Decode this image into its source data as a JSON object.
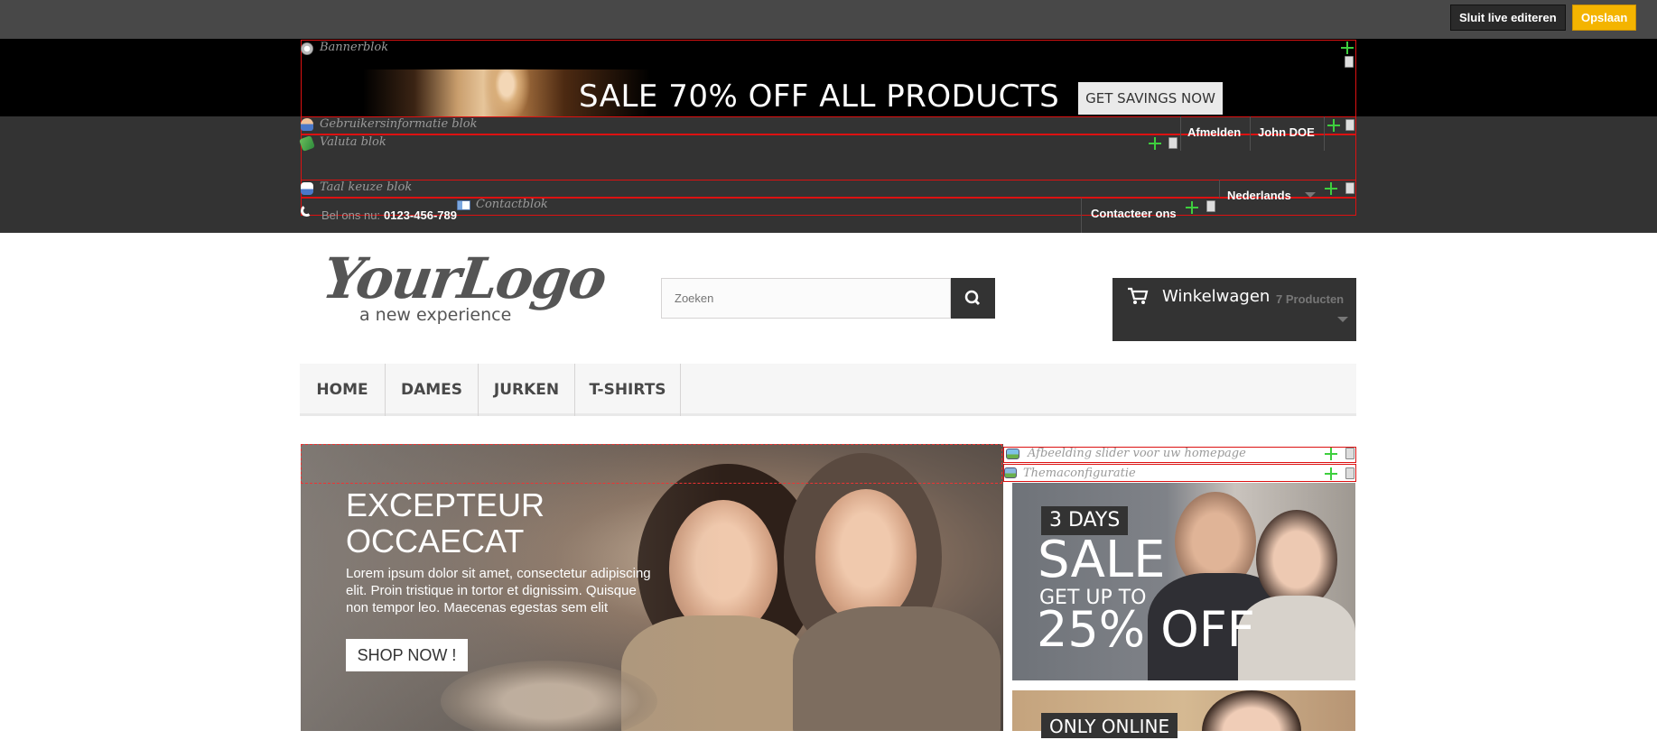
{
  "admin_bar": {
    "close_live_label": "Sluit live editeren",
    "save_label": "Opslaan"
  },
  "modules": {
    "banner": "Bannerblok",
    "user_info": "Gebruikersinformatie blok",
    "currency": "Valuta blok",
    "language": "Taal keuze blok",
    "contact": "Contactblok",
    "slider": "Afbeelding slider voor uw homepage",
    "theme_config": "Themaconfiguratie"
  },
  "banner": {
    "headline": "SALE 70% OFF ALL PRODUCTS",
    "cta": "GET SAVINGS NOW"
  },
  "nav": {
    "logout": "Afmelden",
    "user_name": "John DOE",
    "language": "Nederlands",
    "contact_us": "Contacteer ons",
    "call_label": "Bel ons nu:",
    "phone": "0123-456-789"
  },
  "header": {
    "logo_main": "YourLogo",
    "logo_sub": "a new experience",
    "search_placeholder": "Zoeken",
    "cart_label": "Winkelwagen",
    "cart_count": "7 Producten"
  },
  "menu": {
    "items": [
      "HOME",
      "DAMES",
      "JURKEN",
      "T-SHIRTS"
    ]
  },
  "slider": {
    "title": "EXCEPTEUR OCCAECAT",
    "description": "Lorem ipsum dolor sit amet, consectetur adipiscing elit. Proin tristique in tortor et dignissim. Quisque non tempor leo. Maecenas egestas sem elit",
    "button": "SHOP NOW !"
  },
  "promos": {
    "first": {
      "days": "3 DAYS",
      "sale": "SALE",
      "upto": "GET UP TO",
      "discount": "25% OFF"
    },
    "second": {
      "tag": "ONLY ONLINE"
    }
  },
  "colors": {
    "admin_bar": "#484848",
    "nav_bar": "#333333",
    "save_button": "#f4b400",
    "module_frame": "#dd1111",
    "move_icon": "#3ecf3e"
  }
}
